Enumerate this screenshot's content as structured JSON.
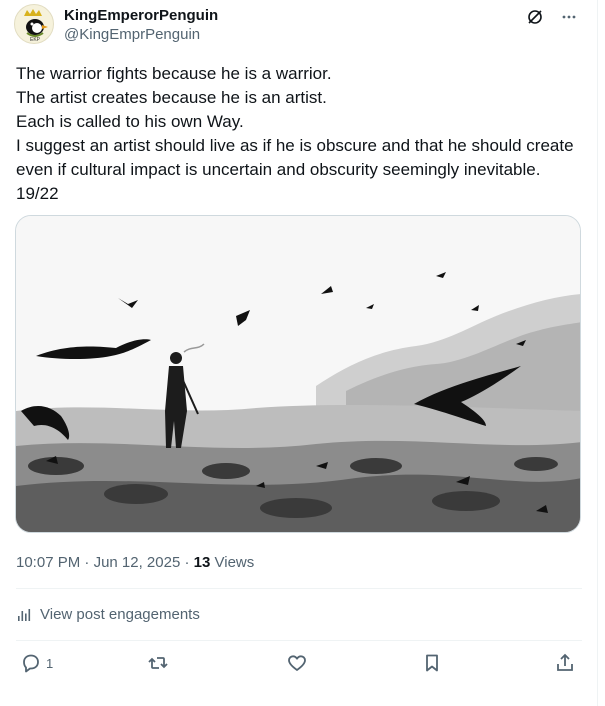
{
  "tweet": {
    "author": {
      "display_name": "KingEmperorPenguin",
      "handle": "@KingEmprPenguin",
      "avatar_label": "EKP"
    },
    "text": "The warrior fights because he is a warrior.\nThe artist creates because he is an artist.\nEach is called to his own Way.\nI suggest an artist should live as if he is obscure and that he should create even if cultural impact is uncertain and obscurity seemingly inevitable. 19/22",
    "image": {
      "type": "ink illustration"
    },
    "time": "10:07 PM",
    "separator": "·",
    "date": "Jun 12, 2025",
    "views_count": "13",
    "views_label": "Views",
    "engagements_label": "View post engagements",
    "reply_count": "1",
    "colors": {
      "text": "#0f1419",
      "secondary": "#536471",
      "border": "#cfd9de"
    },
    "icons": {
      "top": [
        "grok-icon",
        "more-icon"
      ],
      "engagements": "bar-chart-icon",
      "actions": [
        "reply-icon",
        "retweet-icon",
        "like-icon",
        "bookmark-icon",
        "share-icon"
      ]
    }
  }
}
